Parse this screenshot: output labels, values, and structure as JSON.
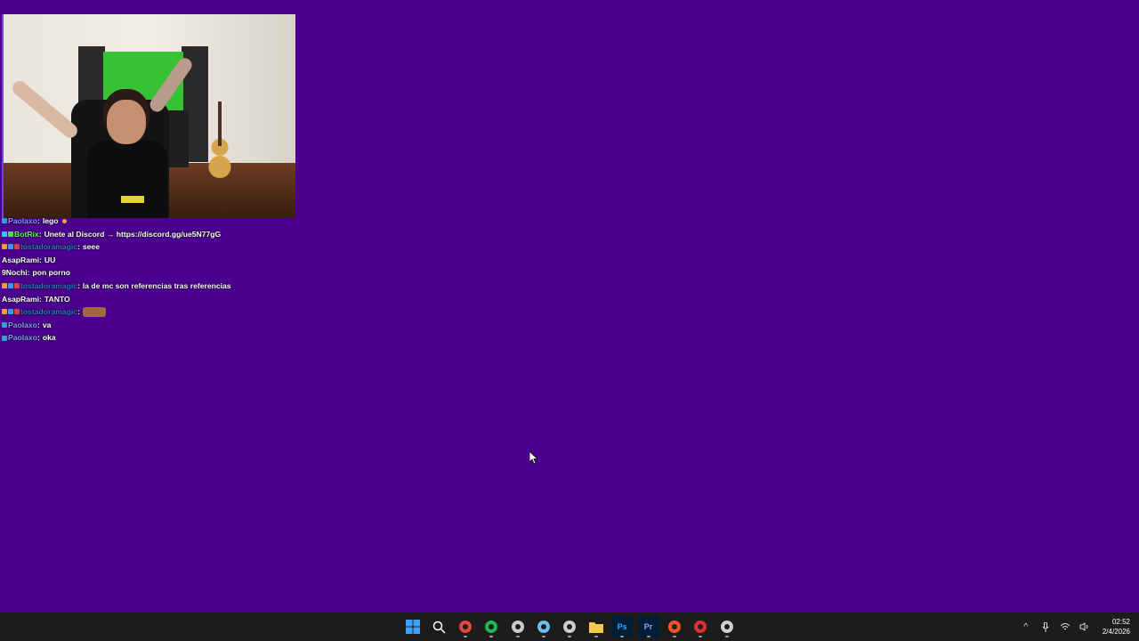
{
  "chat": {
    "lines": [
      {
        "user": "Paolaxo",
        "user_color": "#8a9bff",
        "message": "lego",
        "badges": [
          "#2aa3d8"
        ]
      },
      {
        "user": "BotRix",
        "user_color": "#5cff5c",
        "message": "Unete al Discord → https://discord.gg/ue5N77gG",
        "badges": [
          "#3ec1ff",
          "#5cd35c"
        ]
      },
      {
        "user": "tostadoramagic",
        "user_color": "#2f78d4",
        "message": "seee",
        "badges": [
          "#f0a020",
          "#2aa3d8",
          "#e04040"
        ]
      },
      {
        "user": "AsapRami",
        "user_color": "#ffffff",
        "message": "UU",
        "badges": []
      },
      {
        "user": "9Nochi",
        "user_color": "#ffffff",
        "message": "pon porno",
        "badges": []
      },
      {
        "user": "tostadoramagic",
        "user_color": "#2f78d4",
        "message": "la de mc son referencias tras referencias",
        "badges": [
          "#f0a020",
          "#2aa3d8",
          "#e04040"
        ]
      },
      {
        "user": "AsapRami",
        "user_color": "#ffffff",
        "message": "TANTO",
        "badges": []
      },
      {
        "user": "tostadoramagic",
        "user_color": "#2f78d4",
        "message": "",
        "badges": [
          "#f0a020",
          "#2aa3d8",
          "#e04040"
        ]
      },
      {
        "user": "Paolaxo",
        "user_color": "#8a9bff",
        "message": "va",
        "badges": [
          "#2aa3d8"
        ]
      },
      {
        "user": "Paolaxo",
        "user_color": "#8a9bff",
        "message": "oka",
        "badges": [
          "#2aa3d8"
        ]
      }
    ]
  },
  "taskbar": {
    "apps": [
      {
        "name": "start-icon",
        "color": "#3fa0ff"
      },
      {
        "name": "search-icon",
        "color": "#ffffff"
      },
      {
        "name": "chrome-icon",
        "color": "#e8453c"
      },
      {
        "name": "spotify-icon",
        "color": "#1db954"
      },
      {
        "name": "xbox-icon",
        "color": "#cccccc"
      },
      {
        "name": "steam-icon",
        "color": "#66c0f4"
      },
      {
        "name": "obs-icon",
        "color": "#cfcfcf"
      },
      {
        "name": "folder-icon",
        "color": "#f7c948"
      },
      {
        "name": "photoshop-icon",
        "color": "#31a8ff",
        "label": "Ps"
      },
      {
        "name": "premiere-icon",
        "color": "#9999ff",
        "label": "Pr"
      },
      {
        "name": "brave-icon",
        "color": "#fb542b"
      },
      {
        "name": "streamdeck-icon",
        "color": "#e03030"
      },
      {
        "name": "app-c-icon",
        "color": "#d0d0d0"
      }
    ],
    "clock": {
      "time": "02:52",
      "date": "2/4/2026"
    }
  }
}
